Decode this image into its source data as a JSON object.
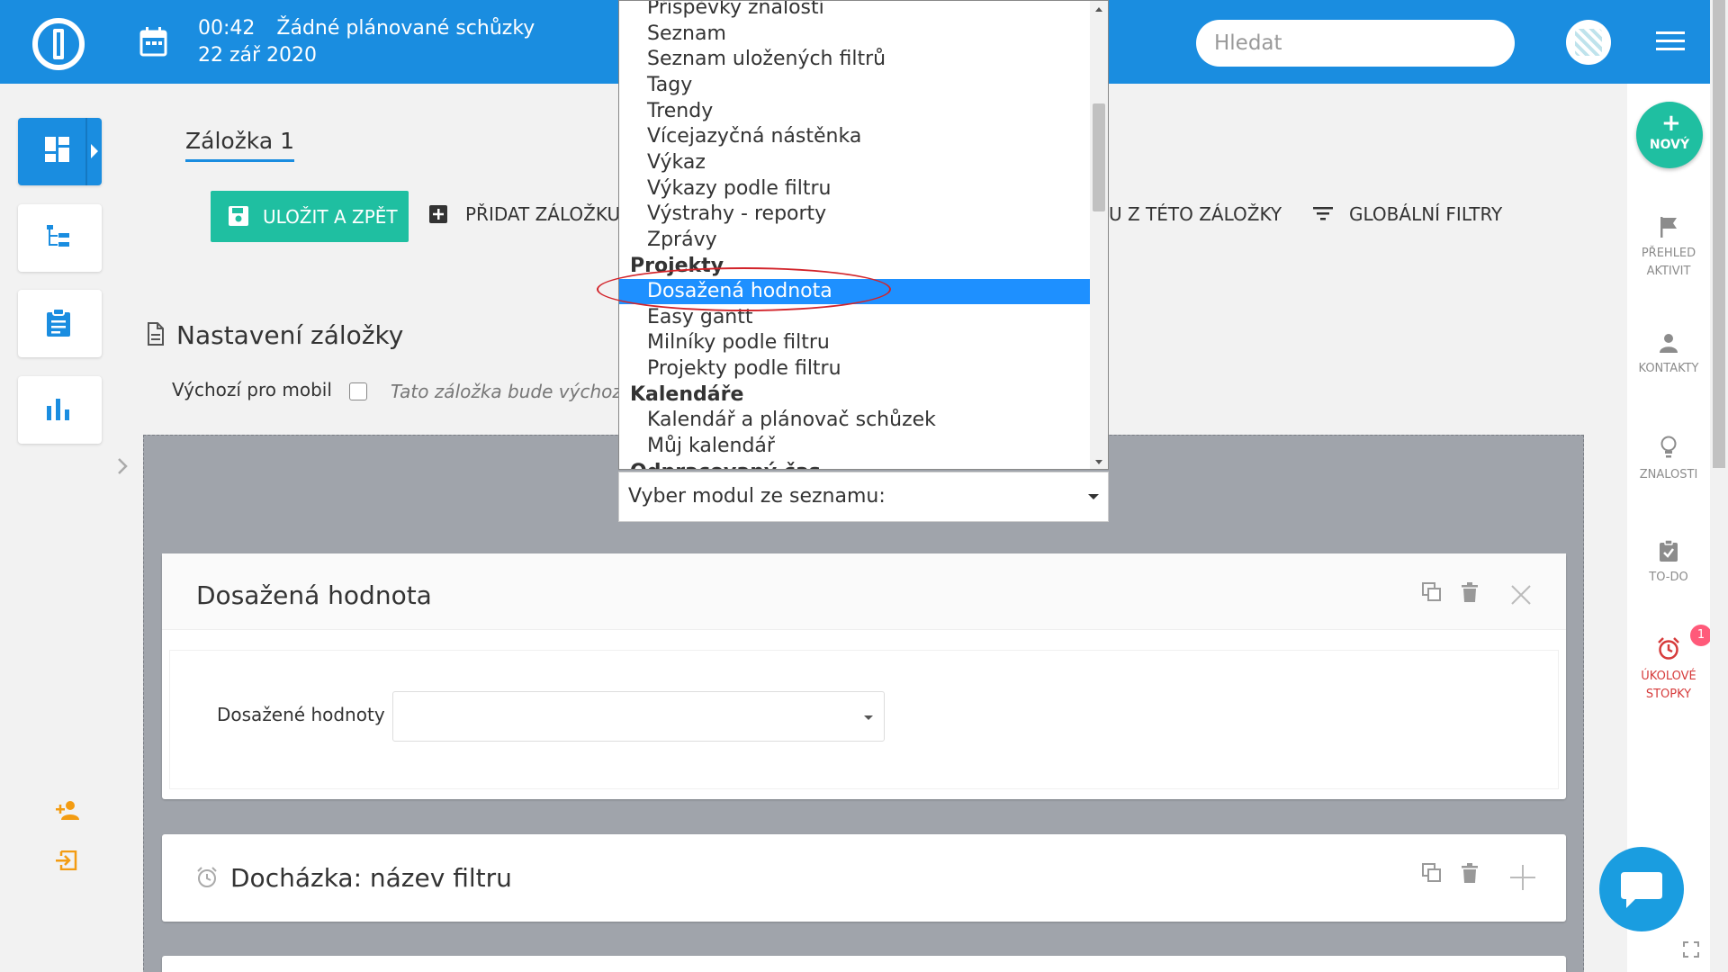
{
  "header": {
    "time": "00:42",
    "meetings": "Žádné plánované schůzky",
    "date": "22 zář 2020",
    "search_placeholder": "Hledat"
  },
  "tab": {
    "label": "Záložka 1"
  },
  "toolbar": {
    "save_label": "ULOŽIT A ZPĚT",
    "add_tab_label": "PŘIDAT ZÁLOŽKU",
    "remove_label_partial": "U Z TÉTO ZÁLOŽKY",
    "global_filters_label": "GLOBÁLNÍ FILTRY"
  },
  "settings": {
    "title": "Nastavení záložky",
    "mobile_label": "Výchozí pro mobil",
    "mobile_checked": false,
    "mobile_desc": "Tato záložka bude výchozí pro mobil"
  },
  "module_select": {
    "value": "Vyber modul ze seznamu:"
  },
  "dropdown": {
    "items": [
      {
        "label": "Příspěvky znalostí",
        "type": "item"
      },
      {
        "label": "Seznam",
        "type": "item"
      },
      {
        "label": "Seznam uložených filtrů",
        "type": "item"
      },
      {
        "label": "Tagy",
        "type": "item"
      },
      {
        "label": "Trendy",
        "type": "item"
      },
      {
        "label": "Vícejazyčná nástěnka",
        "type": "item"
      },
      {
        "label": "Výkaz",
        "type": "item"
      },
      {
        "label": "Výkazy podle filtru",
        "type": "item"
      },
      {
        "label": "Výstrahy - reporty",
        "type": "item"
      },
      {
        "label": "Zprávy",
        "type": "item"
      },
      {
        "label": "Projekty",
        "type": "group"
      },
      {
        "label": "Dosažená hodnota",
        "type": "item",
        "selected": true
      },
      {
        "label": "Easy gantt",
        "type": "item"
      },
      {
        "label": "Milníky podle filtru",
        "type": "item"
      },
      {
        "label": "Projekty podle filtru",
        "type": "item"
      },
      {
        "label": "Kalendáře",
        "type": "group"
      },
      {
        "label": "Kalendář a plánovač schůzek",
        "type": "item"
      },
      {
        "label": "Můj kalendář",
        "type": "item"
      },
      {
        "label": "Odpracovaný čas",
        "type": "group"
      }
    ]
  },
  "cards": [
    {
      "title": "Dosažená hodnota",
      "field_label": "Dosažené hodnoty",
      "field_value": ""
    },
    {
      "title": "Docházka: název filtru"
    }
  ],
  "right_sidebar": {
    "new_label": "NOVÝ",
    "activity_label_1": "PŘEHLED",
    "activity_label_2": "AKTIVIT",
    "contacts_label": "KONTAKTY",
    "knowledge_label": "ZNALOSTI",
    "todo_label": "TO-DO",
    "timers_label_1": "ÚKOLOVÉ",
    "timers_label_2": "STOPKY",
    "timers_badge": "1"
  },
  "colors": {
    "brand_blue": "#1a8de0",
    "accent_green": "#1fbfa1",
    "selection_blue": "#1e90ff",
    "highlight_red": "#d2232a",
    "badge_pink": "#ff5a7a"
  }
}
